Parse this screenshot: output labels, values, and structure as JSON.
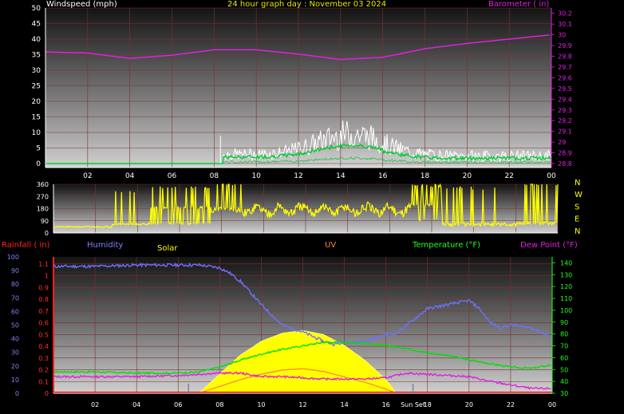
{
  "header": {
    "title": "24 hour graph day : November 03 2024",
    "windspeed_label": "Windspeed (mph)",
    "barometer_label": "Barometer ( in)"
  },
  "bottom_labels": {
    "rainfall": "Rainfall ( in)",
    "humidity": "Humidity",
    "solar": "Solar",
    "uv": "UV",
    "temperature": "Temperature (°F)",
    "dew_point": "Dew Point (°F)",
    "sun_set": "Sun Set"
  },
  "colors": {
    "windspeed": "#ffffff",
    "windspeed_avg": "#00cc33",
    "barometer": "#e020e0",
    "direction": "#ffff00",
    "rainfall": "#ff0000",
    "humidity": "#7070ff",
    "solar": "#ffff00",
    "temperature": "#00e000",
    "dew_point": "#e020e0",
    "uv": "#ff8040"
  },
  "chart_data": [
    {
      "type": "line",
      "name": "wind-barometer",
      "x_ticks": [
        "02",
        "04",
        "06",
        "08",
        "10",
        "12",
        "14",
        "16",
        "18",
        "20",
        "22",
        "00"
      ],
      "y_left_ticks": [
        "0",
        "5",
        "10",
        "15",
        "20",
        "25",
        "30",
        "35",
        "40",
        "45",
        "50"
      ],
      "y_right_ticks": [
        "28.8",
        "28.9",
        "29",
        "29.1",
        "29.2",
        "29.3",
        "29.4",
        "29.5",
        "29.6",
        "29.7",
        "29.8",
        "29.9",
        "30",
        "30.1",
        "30.2"
      ],
      "ylim_left": [
        0,
        50
      ],
      "ylim_right": [
        28.8,
        30.25
      ],
      "series": [
        {
          "name": "Barometer ( in)",
          "axis": "right",
          "x": [
            0,
            2,
            4,
            6,
            8,
            10,
            12,
            14,
            16,
            18,
            20,
            22,
            24
          ],
          "values": [
            29.84,
            29.83,
            29.78,
            29.81,
            29.86,
            29.86,
            29.82,
            29.77,
            29.79,
            29.87,
            29.92,
            29.96,
            30.0
          ]
        }
      ]
    },
    {
      "type": "line",
      "name": "wind-direction",
      "y_ticks": [
        "0",
        "90",
        "180",
        "270",
        "360"
      ],
      "direction_labels": [
        "N",
        "W",
        "S",
        "E",
        "N"
      ],
      "ylim": [
        0,
        360
      ]
    },
    {
      "type": "line",
      "name": "rain-hum-temp-solar",
      "x_ticks": [
        "02",
        "04",
        "06",
        "08",
        "10",
        "12",
        "14",
        "16",
        "Sun Set",
        "18",
        "20",
        "22",
        "00"
      ],
      "humidity_ticks": [
        "0",
        "10",
        "20",
        "30",
        "40",
        "50",
        "60",
        "70",
        "80",
        "90",
        "100"
      ],
      "rainfall_ticks": [
        "0",
        "0.1",
        "0.2",
        "0.3",
        "0.4",
        "0.5",
        "0.6",
        "0.7",
        "0.8",
        "0.9",
        "1",
        "1.1"
      ],
      "temperature_ticks": [
        "30",
        "40",
        "50",
        "60",
        "70",
        "80",
        "90",
        "100",
        "110",
        "120",
        "130",
        "140"
      ],
      "series": [
        {
          "name": "Humidity",
          "x": [
            0,
            2,
            4,
            6,
            7,
            7.5,
            8,
            8.5,
            9,
            10,
            11,
            12,
            13,
            13.5,
            14,
            15,
            16,
            16.5,
            17,
            18,
            19,
            20,
            20.5,
            21,
            21.5,
            22,
            23,
            24
          ],
          "values": [
            93,
            93,
            94,
            94,
            94,
            93,
            92,
            88,
            82,
            65,
            50,
            45,
            38,
            36,
            37,
            38,
            43,
            44,
            50,
            62,
            65,
            68,
            62,
            52,
            48,
            50,
            48,
            41
          ]
        },
        {
          "name": "Temperature (°F)",
          "x": [
            0,
            2,
            4,
            6,
            7,
            8,
            9,
            10,
            11,
            12,
            13,
            14,
            15,
            16,
            17,
            18,
            19,
            20,
            21,
            22,
            23,
            24
          ],
          "values": [
            48,
            48,
            47,
            47,
            48,
            52,
            58,
            63,
            67,
            70,
            73,
            73,
            72,
            70,
            68,
            64,
            62,
            58,
            55,
            52,
            51,
            54
          ]
        },
        {
          "name": "Dew Point (°F)",
          "x": [
            0,
            2,
            4,
            6,
            7,
            8,
            9,
            10,
            11,
            12,
            13,
            14,
            15,
            16,
            17,
            18,
            19,
            20,
            21,
            22,
            23,
            24
          ],
          "values": [
            44,
            44,
            44,
            45,
            46,
            47,
            47,
            44,
            44,
            43,
            42,
            42,
            42,
            43,
            47,
            46,
            45,
            44,
            40,
            37,
            34,
            34
          ]
        },
        {
          "name": "Solar",
          "x": [
            7,
            8,
            9,
            10,
            11,
            12,
            13,
            14,
            15,
            16,
            16.5
          ],
          "values": [
            0,
            14,
            28,
            38,
            44,
            46,
            43,
            35,
            24,
            10,
            0
          ]
        },
        {
          "name": "UV",
          "x": [
            7,
            8,
            9,
            10,
            11,
            12,
            13,
            14,
            15,
            16,
            16.5
          ],
          "values": [
            0,
            5,
            10,
            14,
            17,
            18,
            16,
            12,
            8,
            3,
            0
          ]
        },
        {
          "name": "Rainfall ( in)",
          "x": [
            0,
            24
          ],
          "values": [
            0,
            0
          ]
        }
      ]
    }
  ]
}
